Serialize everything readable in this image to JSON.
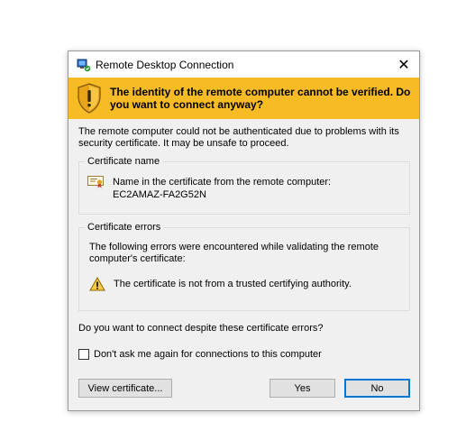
{
  "window": {
    "title": "Remote Desktop Connection",
    "close_glyph": "✕",
    "app_icon": "remote-desktop-icon"
  },
  "banner": {
    "text": "The identity of the remote computer cannot be verified. Do you want to connect anyway?",
    "icon": "shield-icon",
    "color": "#f6bb25"
  },
  "message": "The remote computer could not be authenticated due to problems with its security certificate. It may be unsafe to proceed.",
  "certificate_name": {
    "label": "Certificate name",
    "line1": "Name in the certificate from the remote computer:",
    "line2": "EC2AMAZ-FA2G52N"
  },
  "certificate_errors": {
    "label": "Certificate errors",
    "intro": "The following errors were encountered while validating the remote computer's certificate:",
    "error": "The certificate is not from a trusted certifying authority."
  },
  "question": "Do you want to connect despite these certificate errors?",
  "checkbox": {
    "label": "Don't ask me again for connections to this computer",
    "checked": false
  },
  "buttons": {
    "view": "View certificate...",
    "yes": "Yes",
    "no": "No"
  }
}
